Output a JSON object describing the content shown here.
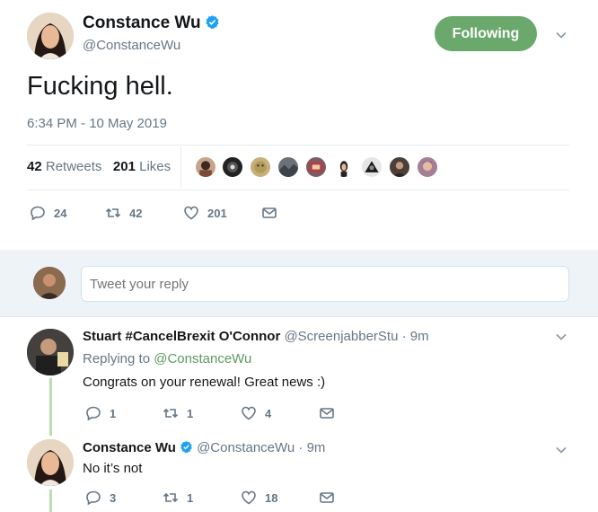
{
  "main": {
    "author_name": "Constance Wu",
    "author_handle": "@ConstanceWu",
    "follow_label": "Following",
    "text": "Fucking hell.",
    "timestamp": "6:34 PM - 10 May 2019",
    "retweets_count": "42",
    "retweets_label": "Retweets",
    "likes_count": "201",
    "likes_label": "Likes",
    "actions": {
      "reply": "24",
      "retweet": "42",
      "like": "201"
    },
    "likers": [
      "liker-1",
      "liker-2",
      "liker-3",
      "liker-4",
      "liker-5",
      "liker-6",
      "liker-7",
      "liker-8",
      "liker-9"
    ]
  },
  "reply_box": {
    "placeholder": "Tweet your reply"
  },
  "replies": [
    {
      "name": "Stuart #CancelBrexit O'Connor",
      "handle": "@ScreenjabberStu",
      "time": "· 9m",
      "replying_label": "Replying to",
      "replying_to": "@ConstanceWu",
      "text": "Congrats on your renewal! Great news :)",
      "actions": {
        "reply": "1",
        "retweet": "1",
        "like": "4"
      }
    },
    {
      "name": "Constance Wu",
      "handle": "@ConstanceWu",
      "time": "· 9m",
      "text": "No it’s not",
      "actions": {
        "reply": "3",
        "retweet": "1",
        "like": "18"
      }
    }
  ],
  "colors": {
    "accent": "#6aa86b",
    "link": "#5d9a5f",
    "muted": "#657786",
    "verified": "#1da1f2"
  }
}
